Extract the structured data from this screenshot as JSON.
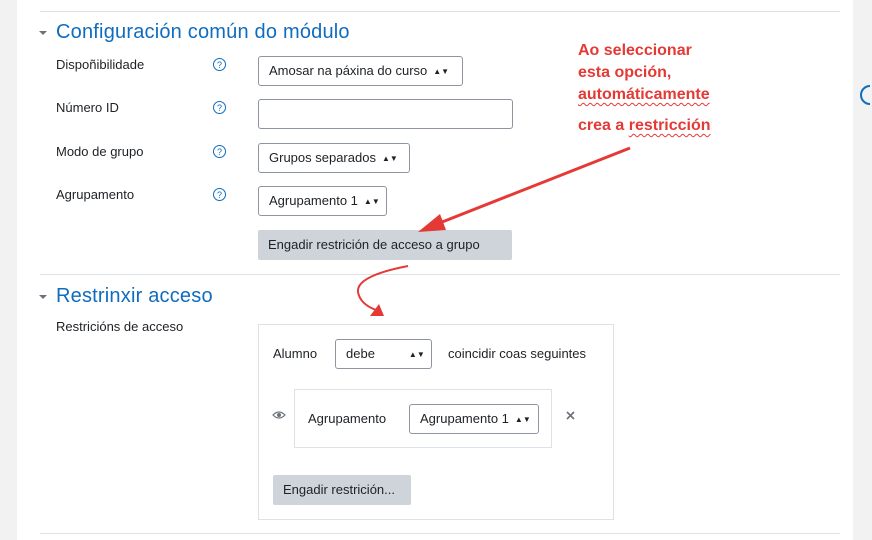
{
  "section1": {
    "title": "Configuración común do módulo",
    "fields": {
      "availability": {
        "label": "Dispoñibilidade",
        "value": "Amosar na páxina do curso"
      },
      "idnumber": {
        "label": "Número ID",
        "value": ""
      },
      "groupmode": {
        "label": "Modo de grupo",
        "value": "Grupos separados"
      },
      "grouping": {
        "label": "Agrupamento",
        "value": "Agrupamento 1"
      }
    },
    "add_group_restriction": "Engadir restrición de acceso a grupo"
  },
  "section2": {
    "title": "Restrinxir acceso",
    "label": "Restricións de acceso",
    "rule": {
      "student_label": "Alumno",
      "must_value": "debe",
      "match_text": "coincidir coas seguintes",
      "condition_label": "Agrupamento",
      "condition_value": "Agrupamento 1"
    },
    "add_restriction": "Engadir restrición..."
  },
  "annotation": {
    "line1": "Ao seleccionar",
    "line2": "esta opción,",
    "line3": "automáticamente",
    "line4_a": "crea a ",
    "line4_b": "restricción",
    "color": "#e53935"
  },
  "icons": {
    "help": "question-circle-icon",
    "collapse": "chevron-down-icon",
    "eye": "eye-icon",
    "delete": "close-icon",
    "select": "sort-arrows-icon"
  },
  "colors": {
    "accent": "#0f6cbf",
    "button": "#ced4da",
    "annotation": "#e53935"
  }
}
